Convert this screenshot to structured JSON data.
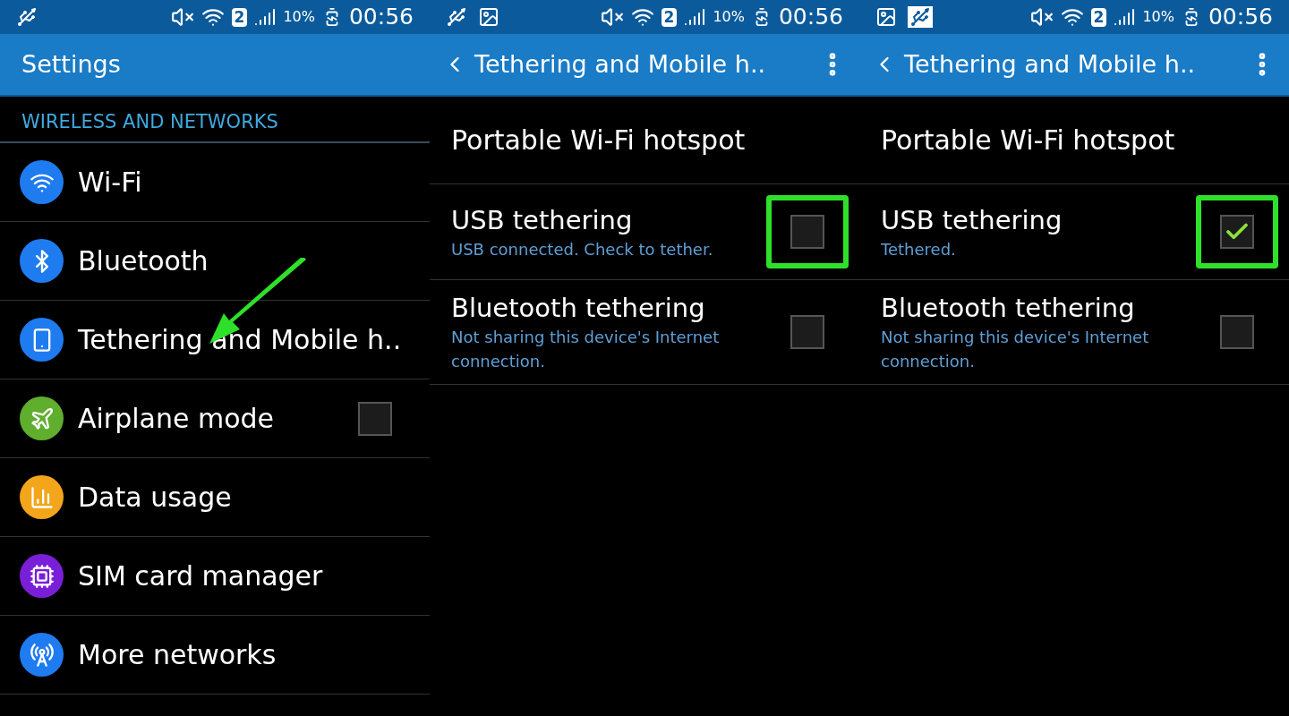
{
  "screens": [
    {
      "status_bar": {
        "left_icons": [
          {
            "kind": "usb",
            "highlighted": false
          }
        ],
        "sim": "2",
        "battery": "10%",
        "time": "00:56"
      },
      "app_bar": {
        "title": "Settings",
        "back": false,
        "menu": false
      },
      "section_header": "WIRELESS AND NETWORKS",
      "items": [
        {
          "kind": "link",
          "title": "Wi-Fi",
          "color": "#1e7cf0",
          "pointed": false
        },
        {
          "kind": "link",
          "title": "Bluetooth",
          "color": "#1e7cf0",
          "pointed": false
        },
        {
          "kind": "link",
          "title": "Tethering and Mobile h..",
          "color": "#1e7cf0",
          "pointed": true
        },
        {
          "kind": "checkbox",
          "title": "Airplane mode",
          "color": "#5fae2e",
          "checked": false,
          "pointed": false
        },
        {
          "kind": "link",
          "title": "Data usage",
          "color": "#f3a51b",
          "pointed": false
        },
        {
          "kind": "link",
          "title": "SIM card manager",
          "color": "#7a1fd8",
          "pointed": false
        },
        {
          "kind": "link",
          "title": "More networks",
          "color": "#1e7cf0",
          "pointed": false
        }
      ]
    },
    {
      "status_bar": {
        "left_icons": [
          {
            "kind": "usb",
            "highlighted": false
          },
          {
            "kind": "image",
            "highlighted": false
          }
        ],
        "sim": "2",
        "battery": "10%",
        "time": "00:56"
      },
      "app_bar": {
        "title": "Tethering and Mobile h..",
        "back": true,
        "menu": true
      },
      "items": [
        {
          "kind": "link",
          "title": "Portable Wi-Fi hotspot"
        },
        {
          "kind": "checkbox",
          "title": "USB tethering",
          "summary": "USB connected. Check to tether.",
          "checked": false,
          "highlighted": true
        },
        {
          "kind": "checkbox",
          "title": "Bluetooth tethering",
          "summary": "Not sharing this device's Internet connection.",
          "checked": false,
          "highlighted": false
        }
      ]
    },
    {
      "status_bar": {
        "left_icons": [
          {
            "kind": "image",
            "highlighted": false
          },
          {
            "kind": "usb",
            "highlighted": true
          }
        ],
        "sim": "2",
        "battery": "10%",
        "time": "00:56"
      },
      "app_bar": {
        "title": "Tethering and Mobile h..",
        "back": true,
        "menu": true
      },
      "items": [
        {
          "kind": "link",
          "title": "Portable Wi-Fi hotspot"
        },
        {
          "kind": "checkbox",
          "title": "USB tethering",
          "summary": "Tethered.",
          "checked": true,
          "highlighted": true
        },
        {
          "kind": "checkbox",
          "title": "Bluetooth tethering",
          "summary": "Not sharing this device's Internet connection.",
          "checked": false,
          "highlighted": false
        }
      ]
    }
  ]
}
